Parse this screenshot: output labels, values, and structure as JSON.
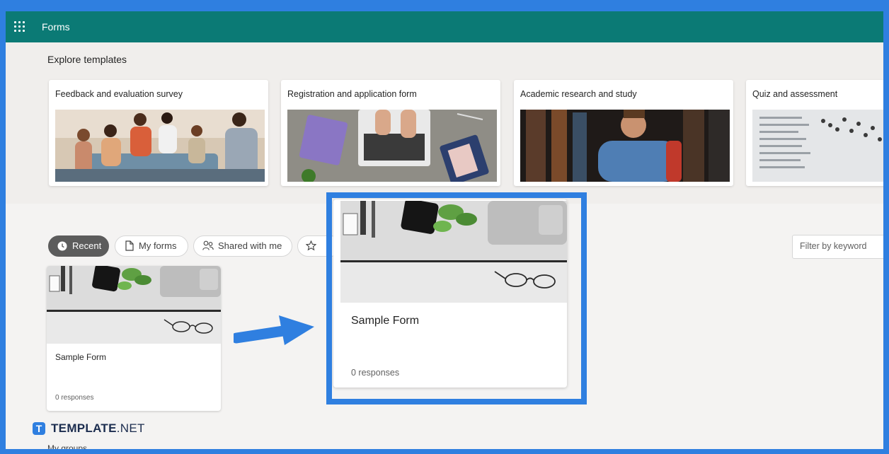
{
  "app": {
    "title": "Forms"
  },
  "explore": {
    "title": "Explore templates",
    "templates": [
      {
        "title": "Feedback and evaluation survey"
      },
      {
        "title": "Registration and application form"
      },
      {
        "title": "Academic research and study"
      },
      {
        "title": "Quiz and assessment"
      }
    ]
  },
  "tabs": [
    {
      "label": "Recent",
      "icon": "clock-icon",
      "active": true
    },
    {
      "label": "My forms",
      "icon": "document-icon"
    },
    {
      "label": "Shared with me",
      "icon": "people-icon"
    },
    {
      "label": "",
      "icon": "star-icon"
    }
  ],
  "filter": {
    "placeholder": "Filter by keyword"
  },
  "forms": [
    {
      "name": "Sample Form",
      "responses": "0 responses"
    }
  ],
  "highlight": {
    "name": "Sample Form",
    "responses": "0 responses"
  },
  "brand": {
    "name": "TEMPLATE",
    "suffix": ".NET",
    "logo_letter": "T"
  },
  "section": {
    "my_groups": "My groups"
  },
  "colors": {
    "topbar": "#0b7a75",
    "highlight": "#2f7fe0",
    "active_chip": "#5c5c5c"
  }
}
